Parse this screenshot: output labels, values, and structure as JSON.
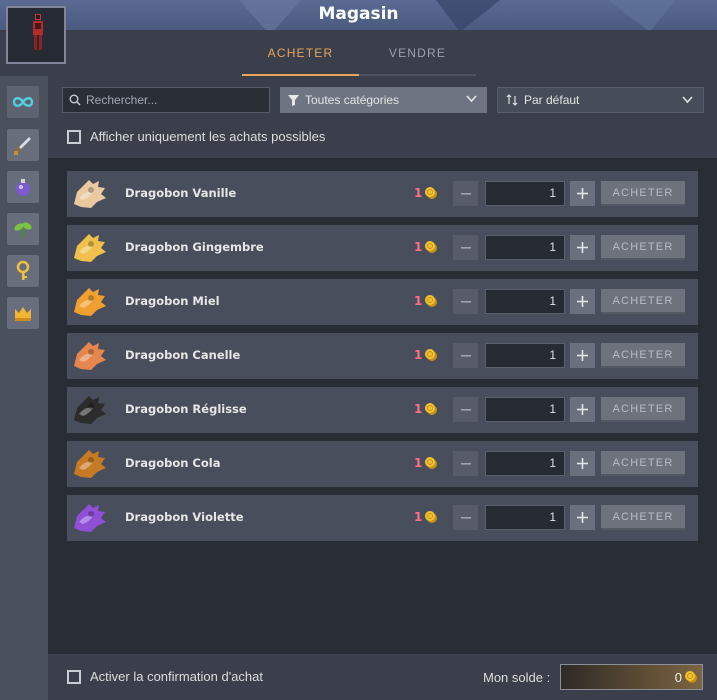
{
  "window": {
    "title": "Magasin"
  },
  "tabs": [
    {
      "label": "ACHETER",
      "active": true
    },
    {
      "label": "VENDRE",
      "active": false
    }
  ],
  "sidebar": {
    "items": [
      {
        "icon": "infinity-icon",
        "active": true
      },
      {
        "icon": "sword-icon",
        "active": false
      },
      {
        "icon": "potion-icon",
        "active": false
      },
      {
        "icon": "plant-icon",
        "active": false
      },
      {
        "icon": "key-icon",
        "active": false
      },
      {
        "icon": "crown-icon",
        "active": false
      }
    ]
  },
  "filters": {
    "search_placeholder": "Rechercher...",
    "category": "Toutes catégories",
    "sort": "Par défaut",
    "affordable_only_label": "Afficher uniquement les achats possibles",
    "affordable_only_checked": false
  },
  "items": [
    {
      "name": "Dragobon Vanille",
      "price": "1",
      "quantity": "1",
      "color": "#e8c9a0"
    },
    {
      "name": "Dragobon Gingembre",
      "price": "1",
      "quantity": "1",
      "color": "#f0c04a"
    },
    {
      "name": "Dragobon Miel",
      "price": "1",
      "quantity": "1",
      "color": "#f0a030"
    },
    {
      "name": "Dragobon Canelle",
      "price": "1",
      "quantity": "1",
      "color": "#e5864f"
    },
    {
      "name": "Dragobon Réglisse",
      "price": "1",
      "quantity": "1",
      "color": "#2c2c2c"
    },
    {
      "name": "Dragobon Cola",
      "price": "1",
      "quantity": "1",
      "color": "#c77a24"
    },
    {
      "name": "Dragobon Violette",
      "price": "1",
      "quantity": "1",
      "color": "#8f4fd6"
    }
  ],
  "buy_label": "ACHETER",
  "footer": {
    "confirm_label": "Activer la confirmation d'achat",
    "confirm_checked": false,
    "balance_label": "Mon solde :",
    "balance_value": "0"
  },
  "colors": {
    "accent": "#e8a45a",
    "price": "#ff6f7f",
    "coin": "#f2c230"
  }
}
